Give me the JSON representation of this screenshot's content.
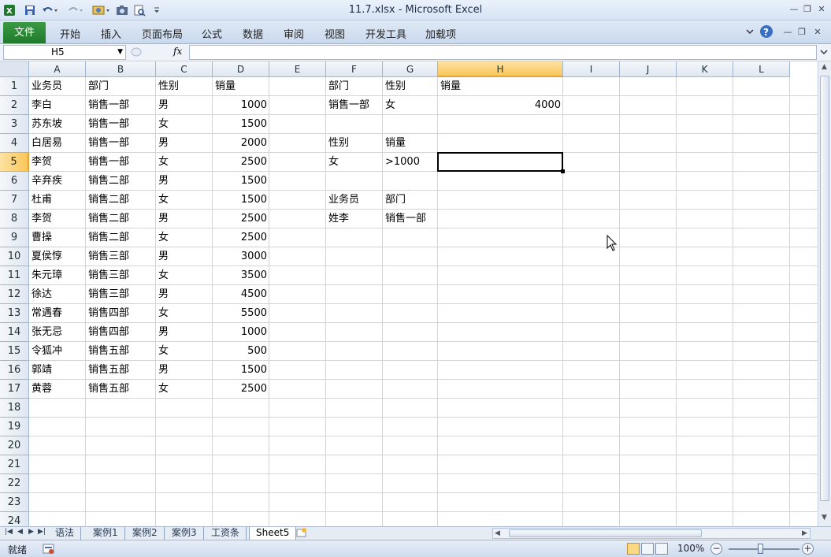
{
  "window": {
    "title": "11.7.xlsx  -  Microsoft Excel",
    "minimize": "—",
    "restore": "❐",
    "close": "✕"
  },
  "ribbon": {
    "file_tab": "文件",
    "tabs": [
      "开始",
      "插入",
      "页面布局",
      "公式",
      "数据",
      "审阅",
      "视图",
      "开发工具",
      "加载项"
    ]
  },
  "formula_bar": {
    "name_box": "H5",
    "fx": "fx",
    "value": ""
  },
  "sheet": {
    "columns": [
      "A",
      "B",
      "C",
      "D",
      "E",
      "F",
      "G",
      "H",
      "I",
      "J",
      "K",
      "L"
    ],
    "rows": [
      "1",
      "2",
      "3",
      "4",
      "5",
      "6",
      "7",
      "8",
      "9",
      "10",
      "11",
      "12",
      "13",
      "14",
      "15",
      "16",
      "17",
      "18",
      "19",
      "20",
      "21",
      "22",
      "23",
      "24"
    ],
    "active_cell": "H5",
    "cells": {
      "A1": "业务员",
      "B1": "部门",
      "C1": "性别",
      "D1": "销量",
      "A2": "李白",
      "B2": "销售一部",
      "C2": "男",
      "D2": "1000",
      "A3": "苏东坡",
      "B3": "销售一部",
      "C3": "女",
      "D3": "1500",
      "A4": "白居易",
      "B4": "销售一部",
      "C4": "男",
      "D4": "2000",
      "A5": "李贺",
      "B5": "销售一部",
      "C5": "女",
      "D5": "2500",
      "A6": "辛弃疾",
      "B6": "销售二部",
      "C6": "男",
      "D6": "1500",
      "A7": "杜甫",
      "B7": "销售二部",
      "C7": "女",
      "D7": "1500",
      "A8": "李贺",
      "B8": "销售二部",
      "C8": "男",
      "D8": "2500",
      "A9": "曹操",
      "B9": "销售二部",
      "C9": "女",
      "D9": "2500",
      "A10": "夏侯惇",
      "B10": "销售三部",
      "C10": "男",
      "D10": "3000",
      "A11": "朱元璋",
      "B11": "销售三部",
      "C11": "女",
      "D11": "3500",
      "A12": "徐达",
      "B12": "销售三部",
      "C12": "男",
      "D12": "4500",
      "A13": "常遇春",
      "B13": "销售四部",
      "C13": "女",
      "D13": "5500",
      "A14": "张无忌",
      "B14": "销售四部",
      "C14": "男",
      "D14": "1000",
      "A15": "令狐冲",
      "B15": "销售五部",
      "C15": "女",
      "D15": "500",
      "A16": "郭靖",
      "B16": "销售五部",
      "C16": "男",
      "D16": "1500",
      "A17": "黄蓉",
      "B17": "销售五部",
      "C17": "女",
      "D17": "2500",
      "F1": "部门",
      "G1": "性别",
      "H1": "销量",
      "F2": "销售一部",
      "G2": "女",
      "H2": "4000",
      "F4": "性别",
      "G4": "销量",
      "F5": "女",
      "G5": ">1000",
      "F7": "业务员",
      "G7": "部门",
      "F8": "姓李",
      "G8": "销售一部"
    },
    "numeric_cells": [
      "D2",
      "D3",
      "D4",
      "D5",
      "D6",
      "D7",
      "D8",
      "D9",
      "D10",
      "D11",
      "D12",
      "D13",
      "D14",
      "D15",
      "D16",
      "D17",
      "H2"
    ]
  },
  "sheet_tabs": {
    "tabs": [
      "语法",
      "案例1",
      "案例2",
      "案例3",
      "工资条",
      "Sheet5"
    ],
    "active": "Sheet5"
  },
  "status": {
    "text": "就绪",
    "zoom": "100%",
    "zoom_level_percent": 100
  },
  "colors": {
    "file_tab": "#1f7a2b",
    "active_header": "#f9c65a",
    "gridline": "#d4d4d4"
  }
}
